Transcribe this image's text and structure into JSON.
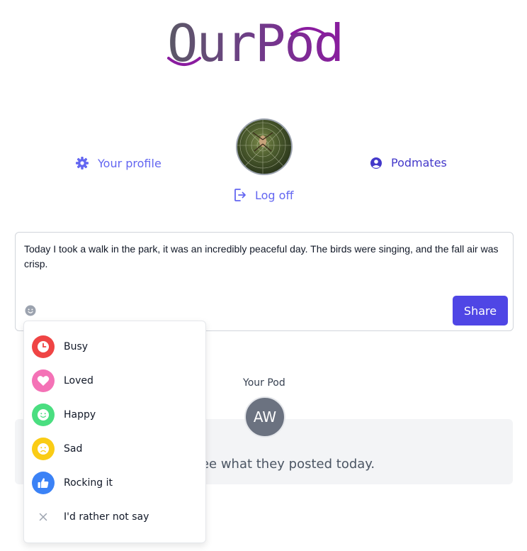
{
  "brand": {
    "name": "OurPod"
  },
  "nav": {
    "profile_label": "Your profile",
    "podmates_label": "Podmates",
    "logoff_label": "Log off"
  },
  "post": {
    "text": "Today I took a walk in the park, it was an incredibly peaceful day. The birds were singing, and the fall air was crisp.",
    "share_label": "Share"
  },
  "pod": {
    "title": "Your Pod",
    "avatar_initials": "AW",
    "message": "ate to see what they posted today."
  },
  "mood_menu": {
    "items": [
      {
        "label": "Busy",
        "icon": "clock-icon",
        "color": "#ef4444"
      },
      {
        "label": "Loved",
        "icon": "heart-icon",
        "color": "#f472b6"
      },
      {
        "label": "Happy",
        "icon": "smile-icon",
        "color": "#4ade80"
      },
      {
        "label": "Sad",
        "icon": "frown-icon",
        "color": "#facc15"
      },
      {
        "label": "Rocking it",
        "icon": "thumbs-up-icon",
        "color": "#3b82f6"
      },
      {
        "label": "I'd rather not say",
        "icon": "x-icon",
        "color": "#9ca3af"
      }
    ]
  },
  "colors": {
    "accent": "#4f46e5",
    "link": "#6366f1",
    "brand_start": "#5b5966",
    "brand_end": "#8a1c9f"
  }
}
